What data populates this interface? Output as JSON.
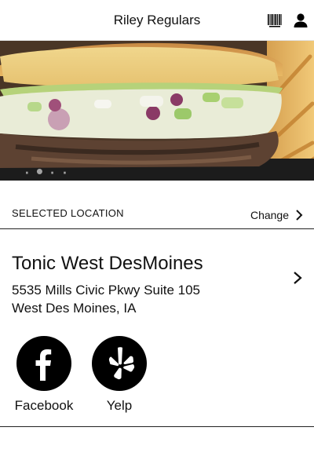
{
  "header": {
    "title": "Riley Regulars",
    "barcode_icon": "barcode-icon",
    "account_icon": "user-icon"
  },
  "hero": {
    "image": "burger-photo"
  },
  "selected_location": {
    "label": "SELECTED LOCATION",
    "change_label": "Change"
  },
  "location": {
    "name": "Tonic West DesMoines",
    "address_line1": "5535 Mills Civic Pkwy Suite 105",
    "address_line2": "West Des Moines, IA"
  },
  "social": [
    {
      "label": "Facebook",
      "icon": "facebook-icon"
    },
    {
      "label": "Yelp",
      "icon": "yelp-icon"
    }
  ],
  "colors": {
    "text": "#111111",
    "background": "#ffffff",
    "divider": "#222222",
    "icon_circle": "#000000"
  }
}
